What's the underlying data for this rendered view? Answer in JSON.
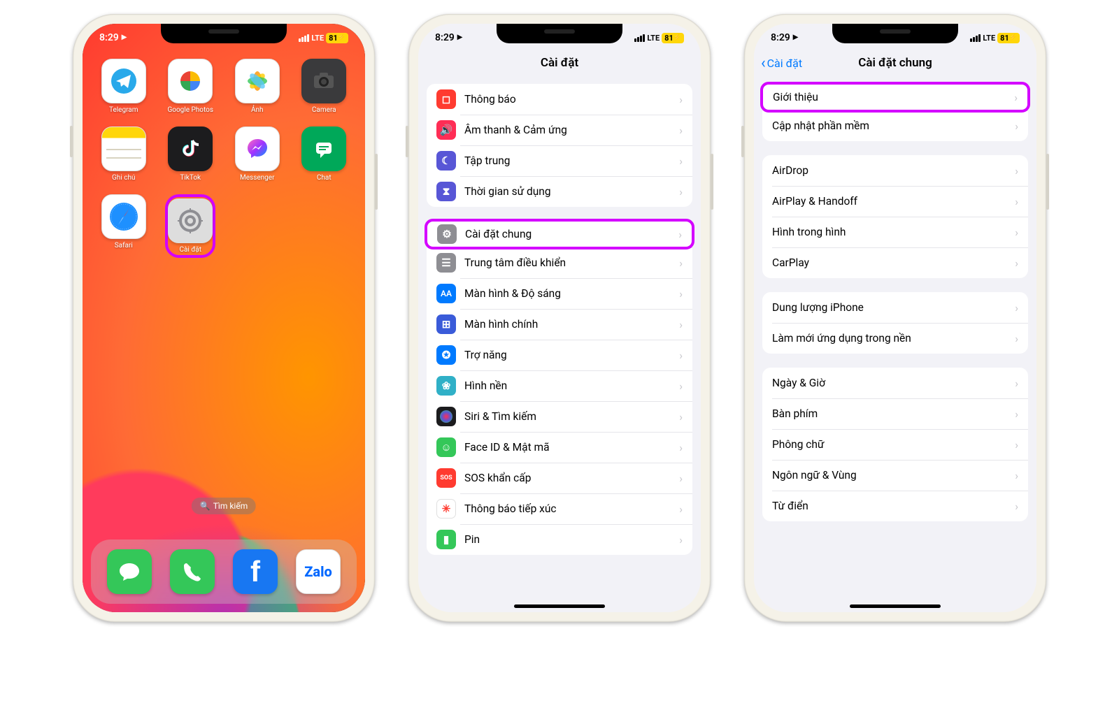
{
  "status": {
    "time": "8:29",
    "carrier": "LTE",
    "battery": "81"
  },
  "home": {
    "search_label": "Tìm kiếm",
    "apps": [
      {
        "label": "Telegram"
      },
      {
        "label": "Google Photos"
      },
      {
        "label": "Ảnh"
      },
      {
        "label": "Camera"
      },
      {
        "label": "Ghi chú"
      },
      {
        "label": "TikTok"
      },
      {
        "label": "Messenger"
      },
      {
        "label": "Chat"
      },
      {
        "label": "Safari"
      },
      {
        "label": "Cài đặt"
      }
    ],
    "dock": [
      "Messages",
      "Phone",
      "Facebook",
      "Zalo"
    ]
  },
  "settings": {
    "title": "Cài đặt",
    "group1": [
      {
        "label": "Thông báo",
        "icon_color": "#ff3b30",
        "glyph": "◻"
      },
      {
        "label": "Âm thanh & Cảm ứng",
        "icon_color": "#ff2d55",
        "glyph": "🔈"
      },
      {
        "label": "Tập trung",
        "icon_color": "#5856d6",
        "glyph": "☾"
      },
      {
        "label": "Thời gian sử dụng",
        "icon_color": "#5856d6",
        "glyph": "⧗"
      }
    ],
    "group2": [
      {
        "label": "Cài đặt chung",
        "icon_color": "#8e8e93",
        "glyph": "⚙",
        "highlight": true
      },
      {
        "label": "Trung tâm điều khiển",
        "icon_color": "#8e8e93",
        "glyph": "☰"
      },
      {
        "label": "Màn hình & Độ sáng",
        "icon_color": "#007aff",
        "glyph": "AA"
      },
      {
        "label": "Màn hình chính",
        "icon_color": "#3a5bd9",
        "glyph": "⊞"
      },
      {
        "label": "Trợ năng",
        "icon_color": "#007aff",
        "glyph": "✪"
      },
      {
        "label": "Hình nền",
        "icon_color": "#30b0c7",
        "glyph": "❀"
      },
      {
        "label": "Siri & Tìm kiếm",
        "icon_color": "#1c1c1e",
        "glyph": "◉"
      },
      {
        "label": "Face ID & Mật mã",
        "icon_color": "#34c759",
        "glyph": "☺"
      },
      {
        "label": "SOS khẩn cấp",
        "icon_color": "#ff3b30",
        "glyph": "SOS"
      },
      {
        "label": "Thông báo tiếp xúc",
        "icon_color": "#ffffff",
        "glyph": "✳"
      },
      {
        "label": "Pin",
        "icon_color": "#34c759",
        "glyph": "▮"
      }
    ]
  },
  "general": {
    "back": "Cài đặt",
    "title": "Cài đặt chung",
    "group1": [
      {
        "label": "Giới thiệu",
        "highlight": true
      },
      {
        "label": "Cập nhật phần mềm"
      }
    ],
    "group2": [
      {
        "label": "AirDrop"
      },
      {
        "label": "AirPlay & Handoff"
      },
      {
        "label": "Hình trong hình"
      },
      {
        "label": "CarPlay"
      }
    ],
    "group3": [
      {
        "label": "Dung lượng iPhone"
      },
      {
        "label": "Làm mới ứng dụng trong nền"
      }
    ],
    "group4": [
      {
        "label": "Ngày & Giờ"
      },
      {
        "label": "Bàn phím"
      },
      {
        "label": "Phông chữ"
      },
      {
        "label": "Ngôn ngữ & Vùng"
      },
      {
        "label": "Từ điển"
      }
    ]
  }
}
